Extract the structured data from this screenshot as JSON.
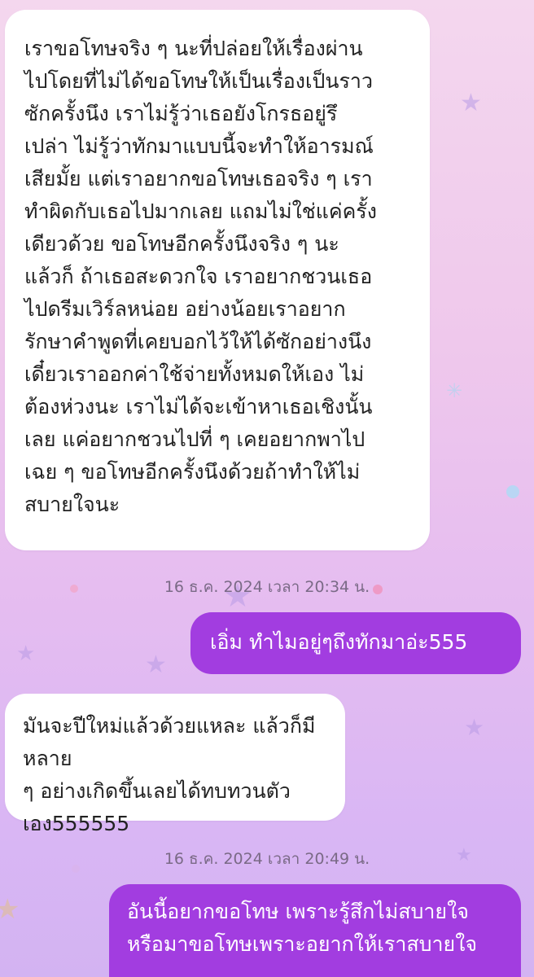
{
  "colors": {
    "incoming_bubble": "#ffffff",
    "outgoing_bubble": "#a23de0",
    "incoming_text": "#222222",
    "outgoing_text": "#ffffff",
    "timestamp_text": "#7a6a86",
    "background_top": "#f4d7ee",
    "background_bottom": "#d3b3f2"
  },
  "messages": [
    {
      "direction": "incoming",
      "text": "เราขอโทษจริง ๆ นะที่ปล่อยให้เรื่องผ่าน\nไปโดยที่ไม่ได้ขอโทษให้เป็นเรื่องเป็นราว\nซักครั้งนึง เราไม่รู้ว่าเธอยังโกรธอยู่รึ\nเปล่า ไม่รู้ว่าทักมาแบบนี้จะทำให้อารมณ์\nเสียมั้ย แต่เราอยากขอโทษเธอจริง ๆ เรา\nทำผิดกับเธอไปมากเลย แถมไม่ใช่แค่ครั้ง\nเดียวด้วย ขอโทษอีกครั้งนึงจริง ๆ นะ\nแล้วก็ ถ้าเธอสะดวกใจ เราอยากชวนเธอ\nไปดรีมเวิร์ลหน่อย อย่างน้อยเราอยาก\nรักษาคำพูดที่เคยบอกไว้ให้ได้ซักอย่างนึง\nเดี๋ยวเราออกค่าใช้จ่ายทั้งหมดให้เอง ไม่\nต้องห่วงนะ เราไม่ได้จะเข้าหาเธอเชิงนั้น\nเลย แค่อยากชวนไปที่ ๆ เคยอยากพาไป\nเฉย ๆ ขอโทษอีกครั้งนึงด้วยถ้าทำให้ไม่\nสบายใจนะ"
    },
    {
      "direction": "timestamp",
      "text": "16 ธ.ค. 2024 เวลา 20:34 น."
    },
    {
      "direction": "outgoing",
      "text": "เอิ่ม ทำไมอยู่ๆถึงทักมาอ่ะ555"
    },
    {
      "direction": "incoming",
      "text": "มันจะปีใหม่แล้วด้วยแหละ แล้วก็มีหลาย\nๆ อย่างเกิดขึ้นเลยได้ทบทวนตัว\nเอง555555"
    },
    {
      "direction": "timestamp",
      "text": "16 ธ.ค. 2024 เวลา 20:49 น."
    },
    {
      "direction": "outgoing",
      "text": "อันนี้อยากขอโทษ เพราะรู้สึกไม่สบายใจ\nหรือมาขอโทษเพราะอยากให้เราสบายใจ"
    }
  ]
}
